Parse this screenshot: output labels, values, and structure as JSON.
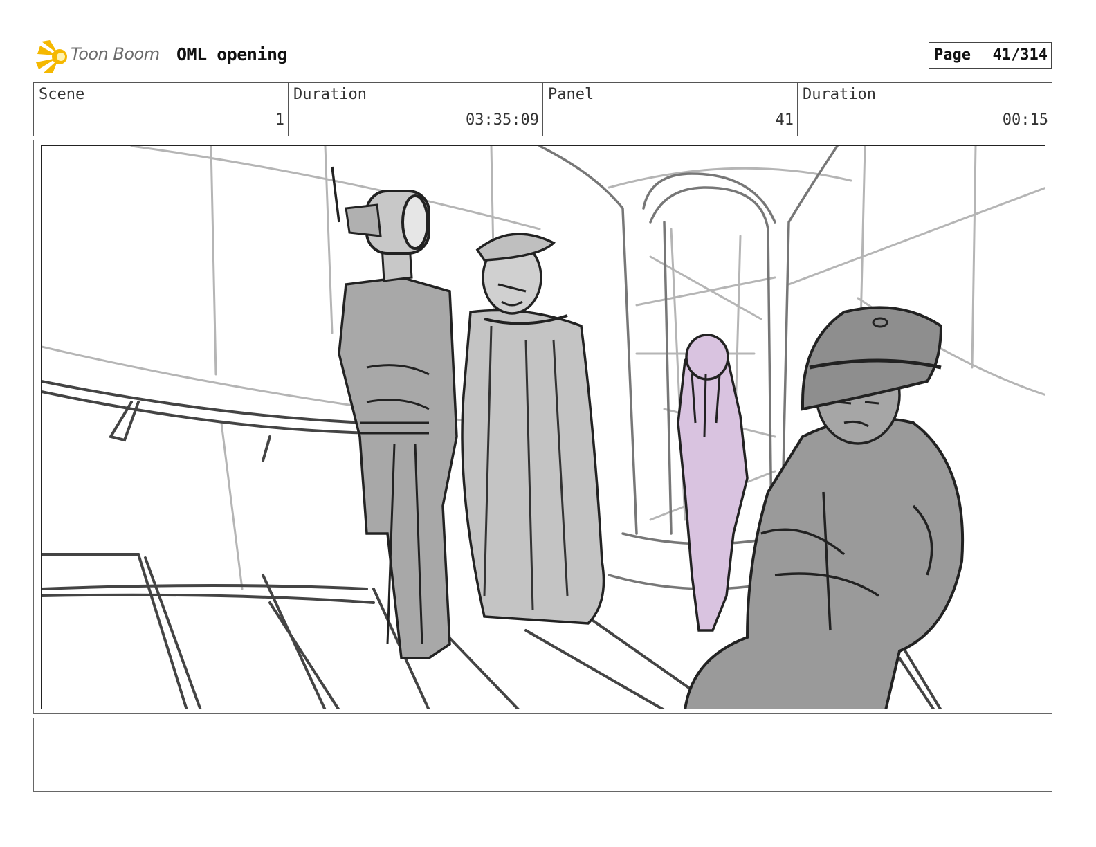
{
  "header": {
    "logo_text": "Toon Boom",
    "project_title": "OML opening",
    "page_label": "Page",
    "page_value": "41/314"
  },
  "info": {
    "scene_label": "Scene",
    "scene_value": "1",
    "scene_duration_label": "Duration",
    "scene_duration_value": "03:35:09",
    "panel_label": "Panel",
    "panel_value": "41",
    "panel_duration_label": "Duration",
    "panel_duration_value": "00:15"
  },
  "colors": {
    "logo_accent": "#f5b800",
    "figure_fill": "#a8a8a8",
    "highlight_fill": "#d9c3e0"
  },
  "panel": {
    "image": "storyboard-sketch"
  },
  "notes": {
    "text": ""
  }
}
